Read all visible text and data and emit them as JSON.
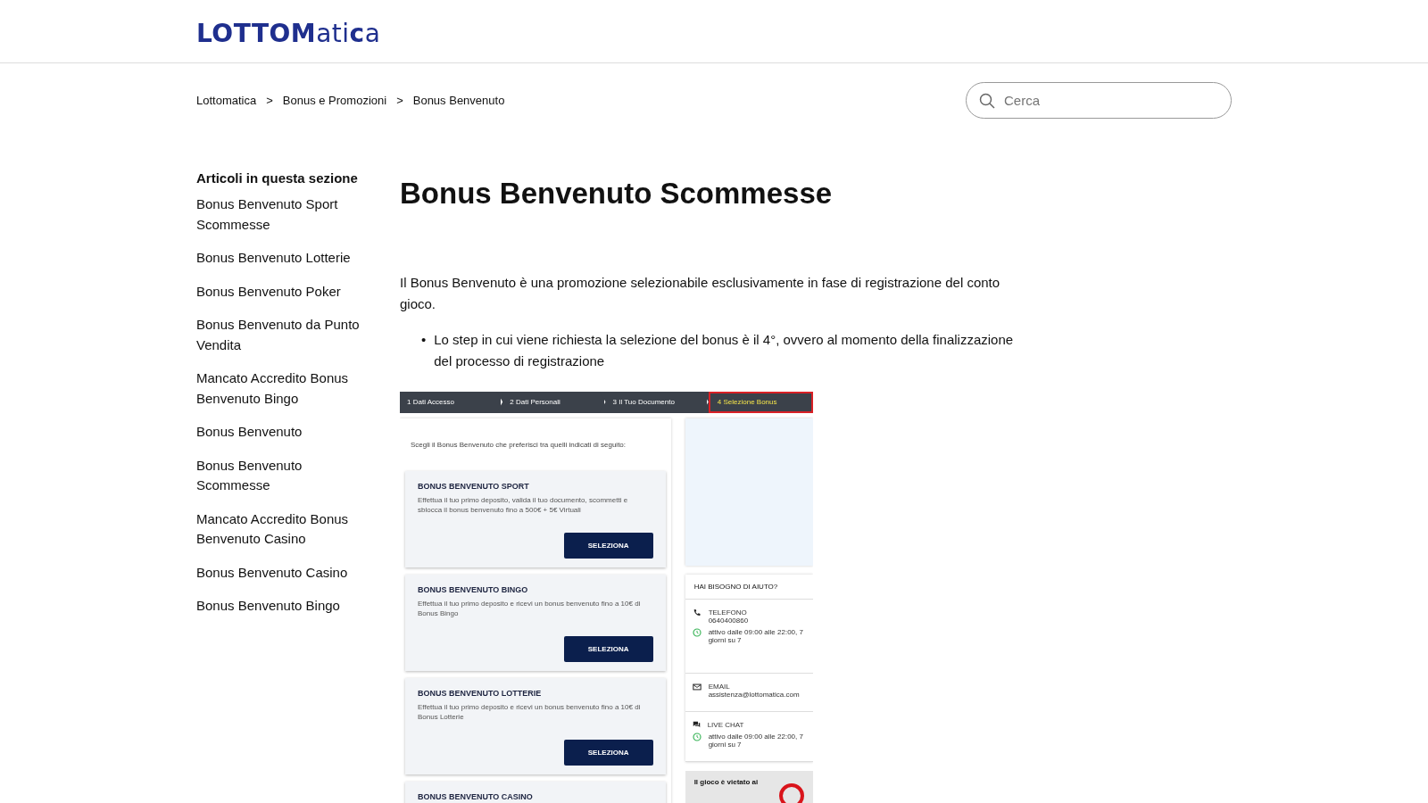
{
  "header": {
    "logo": "**LOTTOM**ati**c**a"
  },
  "breadcrumbs": [
    "Lottomatica",
    "Bonus e Promozioni",
    "Bonus Benvenuto"
  ],
  "breadcrumb_separator": ">",
  "search": {
    "placeholder": "Cerca"
  },
  "sidebar": {
    "title": "Articoli in questa sezione",
    "items": [
      {
        "label": "Bonus Benvenuto Sport Scommesse"
      },
      {
        "label": "Bonus Benvenuto Lotterie"
      },
      {
        "label": "Bonus Benvenuto Poker"
      },
      {
        "label": "Bonus Benvenuto da Punto Vendita"
      },
      {
        "label": "Mancato Accredito Bonus Benvenuto Bingo"
      },
      {
        "label": "Bonus Benvenuto"
      },
      {
        "label": "Bonus Benvenuto Scommesse"
      },
      {
        "label": "Mancato Accredito Bonus Benvenuto Casino"
      },
      {
        "label": "Bonus Benvenuto Casino"
      },
      {
        "label": "Bonus Benvenuto Bingo"
      }
    ]
  },
  "article": {
    "title": "Bonus Benvenuto Scommesse",
    "intro": "Il Bonus Benvenuto è una promozione selezionabile esclusivamente in fase di registrazione del conto gioco.",
    "bullet_marker": "•",
    "bullets": [
      "Lo step in cui viene richiesta la selezione del bonus è il 4°, ovvero al momento della finalizzazione del processo di registrazione"
    ],
    "screenshot": {
      "steps": [
        {
          "number": "1",
          "label": "Dati Accesso",
          "selected": false
        },
        {
          "number": "2",
          "label": "Dati Personali",
          "selected": false
        },
        {
          "number": "3",
          "label": "Il Tuo Documento",
          "selected": false
        },
        {
          "number": "4",
          "label": "Selezione Bonus",
          "selected": true
        }
      ],
      "prompt": "Scegli il Bonus Benvenuto che preferisci tra quelli indicati di seguito:",
      "bonuses": [
        {
          "title": "BONUS BENVENUTO SPORT",
          "text": "Effettua il tuo primo deposito, valida il tuo documento, scommetti e sblocca il bonus benvenuto fino a 500€ + 5€ Virtuali",
          "button": "SELEZIONA"
        },
        {
          "title": "BONUS BENVENUTO BINGO",
          "text": "Effettua il tuo primo deposito e ricevi un bonus benvenuto fino a 10€ di Bonus Bingo",
          "button": "SELEZIONA"
        },
        {
          "title": "BONUS BENVENUTO LOTTERIE",
          "text": "Effettua il tuo primo deposito e ricevi un bonus benvenuto fino a 10€ di Bonus Lotterie",
          "button": "SELEZIONA"
        },
        {
          "title": "BONUS BENVENUTO CASINO"
        }
      ],
      "help": {
        "title": "HAI BISOGNO DI AIUTO?",
        "contacts": [
          {
            "kind": "phone",
            "label": "TELEFONO",
            "value": "0640400860",
            "hours": "attivo dalle 09:00 alle 22:00, 7 giorni su 7"
          },
          {
            "kind": "email",
            "label": "EMAIL",
            "value": "assistenza@lottomatica.com"
          },
          {
            "kind": "chat",
            "label": "LIVE CHAT",
            "hours": "attivo dalle 09:00 alle 22:00, 7 giorni su 7"
          }
        ]
      },
      "warning": "Il gioco è vietato ai"
    }
  }
}
